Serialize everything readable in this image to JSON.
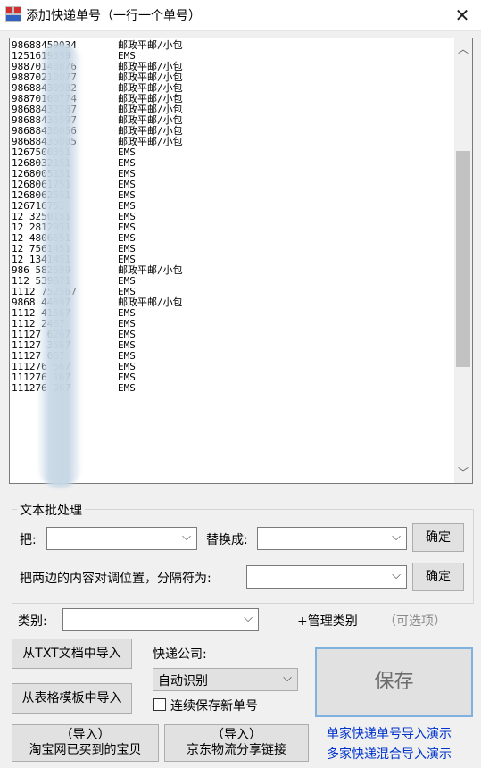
{
  "window": {
    "title": "添加快递单号（一行一个单号）"
  },
  "list": {
    "rows": [
      [
        "98688459034",
        "邮政平邮/小包"
      ],
      [
        "1251619399",
        "EMS"
      ],
      [
        "98870140876",
        "邮政平邮/小包"
      ],
      [
        "98870210977",
        "邮政平邮/小包"
      ],
      [
        "98688430982",
        "邮政平邮/小包"
      ],
      [
        "98870100774",
        "邮政平邮/小包"
      ],
      [
        "98688432787",
        "邮政平邮/小包"
      ],
      [
        "98688436597",
        "邮政平邮/小包"
      ],
      [
        "98688436056",
        "邮政平邮/小包"
      ],
      [
        "98688435005",
        "邮政平邮/小包"
      ],
      [
        "1267500351",
        "EMS"
      ],
      [
        "1268032151",
        "EMS"
      ],
      [
        "1268005151",
        "EMS"
      ],
      [
        "1268061751",
        "EMS"
      ],
      [
        "1268062551",
        "EMS"
      ],
      [
        "126716751",
        "EMS"
      ],
      [
        "12 3250151",
        "EMS"
      ],
      [
        "12 2812951",
        "EMS"
      ],
      [
        "12 4806651",
        "EMS"
      ],
      [
        "12 7561451",
        "EMS"
      ],
      [
        "12 1341451",
        "EMS"
      ],
      [
        "986 582599",
        "邮政平邮/小包"
      ],
      [
        "112 539871",
        "EMS"
      ],
      [
        "1112 752567",
        "EMS"
      ],
      [
        "9868 44897",
        "邮政平邮/小包"
      ],
      [
        "1112 41567",
        "EMS"
      ],
      [
        "1112 2467",
        "EMS"
      ],
      [
        "11127 6267",
        "EMS"
      ],
      [
        "11127 3567",
        "EMS"
      ],
      [
        "11127 067",
        "EMS"
      ],
      [
        "111276 567",
        "EMS"
      ],
      [
        "111276 167",
        "EMS"
      ],
      [
        "111276 967",
        "EMS"
      ]
    ]
  },
  "batch": {
    "group_title": "文本批处理",
    "find_label": "把:",
    "find_value": "",
    "replace_label": "替换成:",
    "replace_value": "",
    "ok_label": "确定",
    "swap_label": "把两边的内容对调位置，分隔符为:",
    "swap_value": "",
    "swap_ok_label": "确定"
  },
  "category": {
    "label": "类别:",
    "value": "",
    "manage_link": "+管理类别",
    "optional_hint": "（可选项）"
  },
  "import": {
    "txt_label": "从TXT文档中导入",
    "excel_label": "从表格模板中导入",
    "taobao_line1": "（导入）",
    "taobao_line2": "淘宝网已买到的宝贝",
    "jd_line1": "（导入）",
    "jd_line2": "京东物流分享链接"
  },
  "courier": {
    "label": "快递公司:",
    "selected": "自动识别",
    "continuous_save_label": "连续保存新单号",
    "continuous_save_checked": false
  },
  "save_label": "保存",
  "demo_links": {
    "single": "单家快递单号导入演示",
    "mixed": "多家快递混合导入演示"
  },
  "icons": {
    "app": "app-icon",
    "close": "close-icon",
    "dropdown": "chevron-down-icon",
    "scroll_up": "scroll-up-arrow-icon",
    "scroll_down": "scroll-down-arrow-icon"
  },
  "colors": {
    "link": "#0033cc",
    "save_border": "#7fb2e0",
    "window_bg": "#f0f0f0"
  }
}
